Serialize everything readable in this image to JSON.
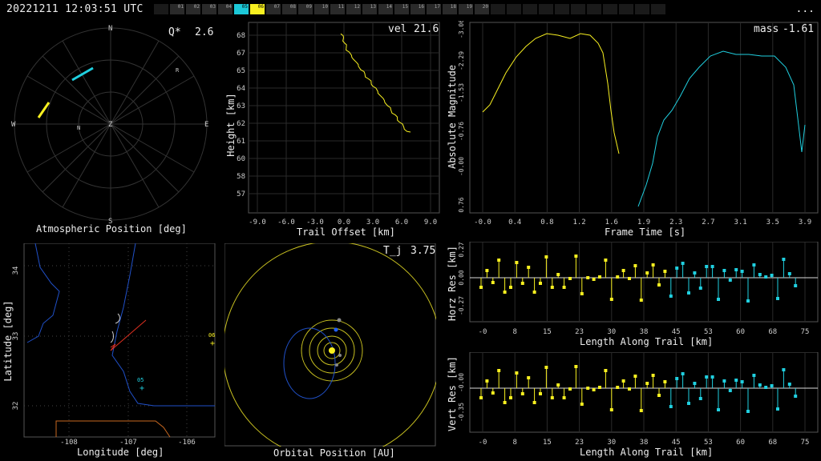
{
  "header": {
    "timestamp": "20221211 12:03:51 UTC",
    "menu_label": "...",
    "cameras": [
      {
        "id": "",
        "state": "off"
      },
      {
        "id": "01",
        "state": "idle"
      },
      {
        "id": "02",
        "state": "idle"
      },
      {
        "id": "03",
        "state": "idle"
      },
      {
        "id": "04",
        "state": "idle"
      },
      {
        "id": "05",
        "state": "cyan"
      },
      {
        "id": "06",
        "state": "yellow"
      },
      {
        "id": "07",
        "state": "idle"
      },
      {
        "id": "08",
        "state": "idle"
      },
      {
        "id": "09",
        "state": "idle"
      },
      {
        "id": "10",
        "state": "idle"
      },
      {
        "id": "11",
        "state": "idle"
      },
      {
        "id": "12",
        "state": "idle"
      },
      {
        "id": "13",
        "state": "idle"
      },
      {
        "id": "14",
        "state": "idle"
      },
      {
        "id": "15",
        "state": "idle"
      },
      {
        "id": "16",
        "state": "idle"
      },
      {
        "id": "17",
        "state": "idle"
      },
      {
        "id": "18",
        "state": "idle"
      },
      {
        "id": "19",
        "state": "idle"
      },
      {
        "id": "20",
        "state": "idle"
      },
      {
        "id": "",
        "state": "off"
      },
      {
        "id": "",
        "state": "off"
      },
      {
        "id": "",
        "state": "off"
      },
      {
        "id": "",
        "state": "off"
      },
      {
        "id": "",
        "state": "off"
      },
      {
        "id": "",
        "state": "off"
      },
      {
        "id": "",
        "state": "off"
      },
      {
        "id": "",
        "state": "off"
      },
      {
        "id": "",
        "state": "off"
      },
      {
        "id": "",
        "state": "off"
      },
      {
        "id": "",
        "state": "off"
      }
    ]
  },
  "colors": {
    "yellow": "#f8f020",
    "cyan": "#20d0e0",
    "grid": "#333333",
    "axis": "#bbbbbb",
    "blue": "#2050c8",
    "orange": "#c86820",
    "red": "#e03020"
  },
  "atmos": {
    "title": "Atmospheric Position [deg]",
    "q_label": "Q*",
    "q_value": "2.6",
    "n": "N",
    "s": "S",
    "e": "E",
    "w": "W",
    "z": "Z",
    "marker_r": "R",
    "marker_n": "N"
  },
  "heightplot": {
    "title": "Trail Offset [km]",
    "ylabel": "Height [km]",
    "vel_label": "vel",
    "vel_value": "21.6",
    "xticks": [
      "-9.0",
      "-6.0",
      "-3.0",
      "0.0",
      "3.0",
      "6.0",
      "9.0"
    ],
    "yticks": [
      "68",
      "67",
      "65",
      "64",
      "63",
      "62",
      "61",
      "60",
      "58",
      "57"
    ]
  },
  "magplot": {
    "xlabel": "Frame Time [s]",
    "ylabel": "Absolute Magnitude",
    "mass_label": "mass",
    "mass_value": "-1.61",
    "xticks": [
      "-0.0",
      "0.4",
      "0.8",
      "1.2",
      "1.6",
      "1.9",
      "2.3",
      "2.7",
      "3.1",
      "3.5",
      "3.9"
    ],
    "yticks": [
      "-3.06",
      "-2.29",
      "-1.53",
      "-0.76",
      "-0.00",
      "0.76"
    ]
  },
  "mapplot": {
    "xlabel": "Longitude [deg]",
    "ylabel": "Latitude [deg]",
    "xticks": [
      "-108",
      "-107",
      "-106"
    ],
    "yticks": [
      "34",
      "33",
      "32"
    ],
    "station_a": "06",
    "station_b": "05"
  },
  "orbit": {
    "title": "Orbital Position [AU]",
    "tj_label": "T_j",
    "tj_value": "3.75"
  },
  "horz": {
    "xlabel": "Length Along Trail [km]",
    "ylabel": "Horz Res [km]",
    "xticks": [
      "-0",
      "8",
      "15",
      "23",
      "30",
      "38",
      "45",
      "53",
      "60",
      "68",
      "75"
    ],
    "yticks": [
      "0.27",
      "0.00",
      "-0.27"
    ]
  },
  "vert": {
    "xlabel": "Length Along Trail [km]",
    "ylabel": "Vert Res [km]",
    "xticks": [
      "-0",
      "8",
      "15",
      "23",
      "30",
      "38",
      "45",
      "53",
      "60",
      "68",
      "75"
    ],
    "yticks": [
      "-0.00",
      "-0.35"
    ]
  }
}
